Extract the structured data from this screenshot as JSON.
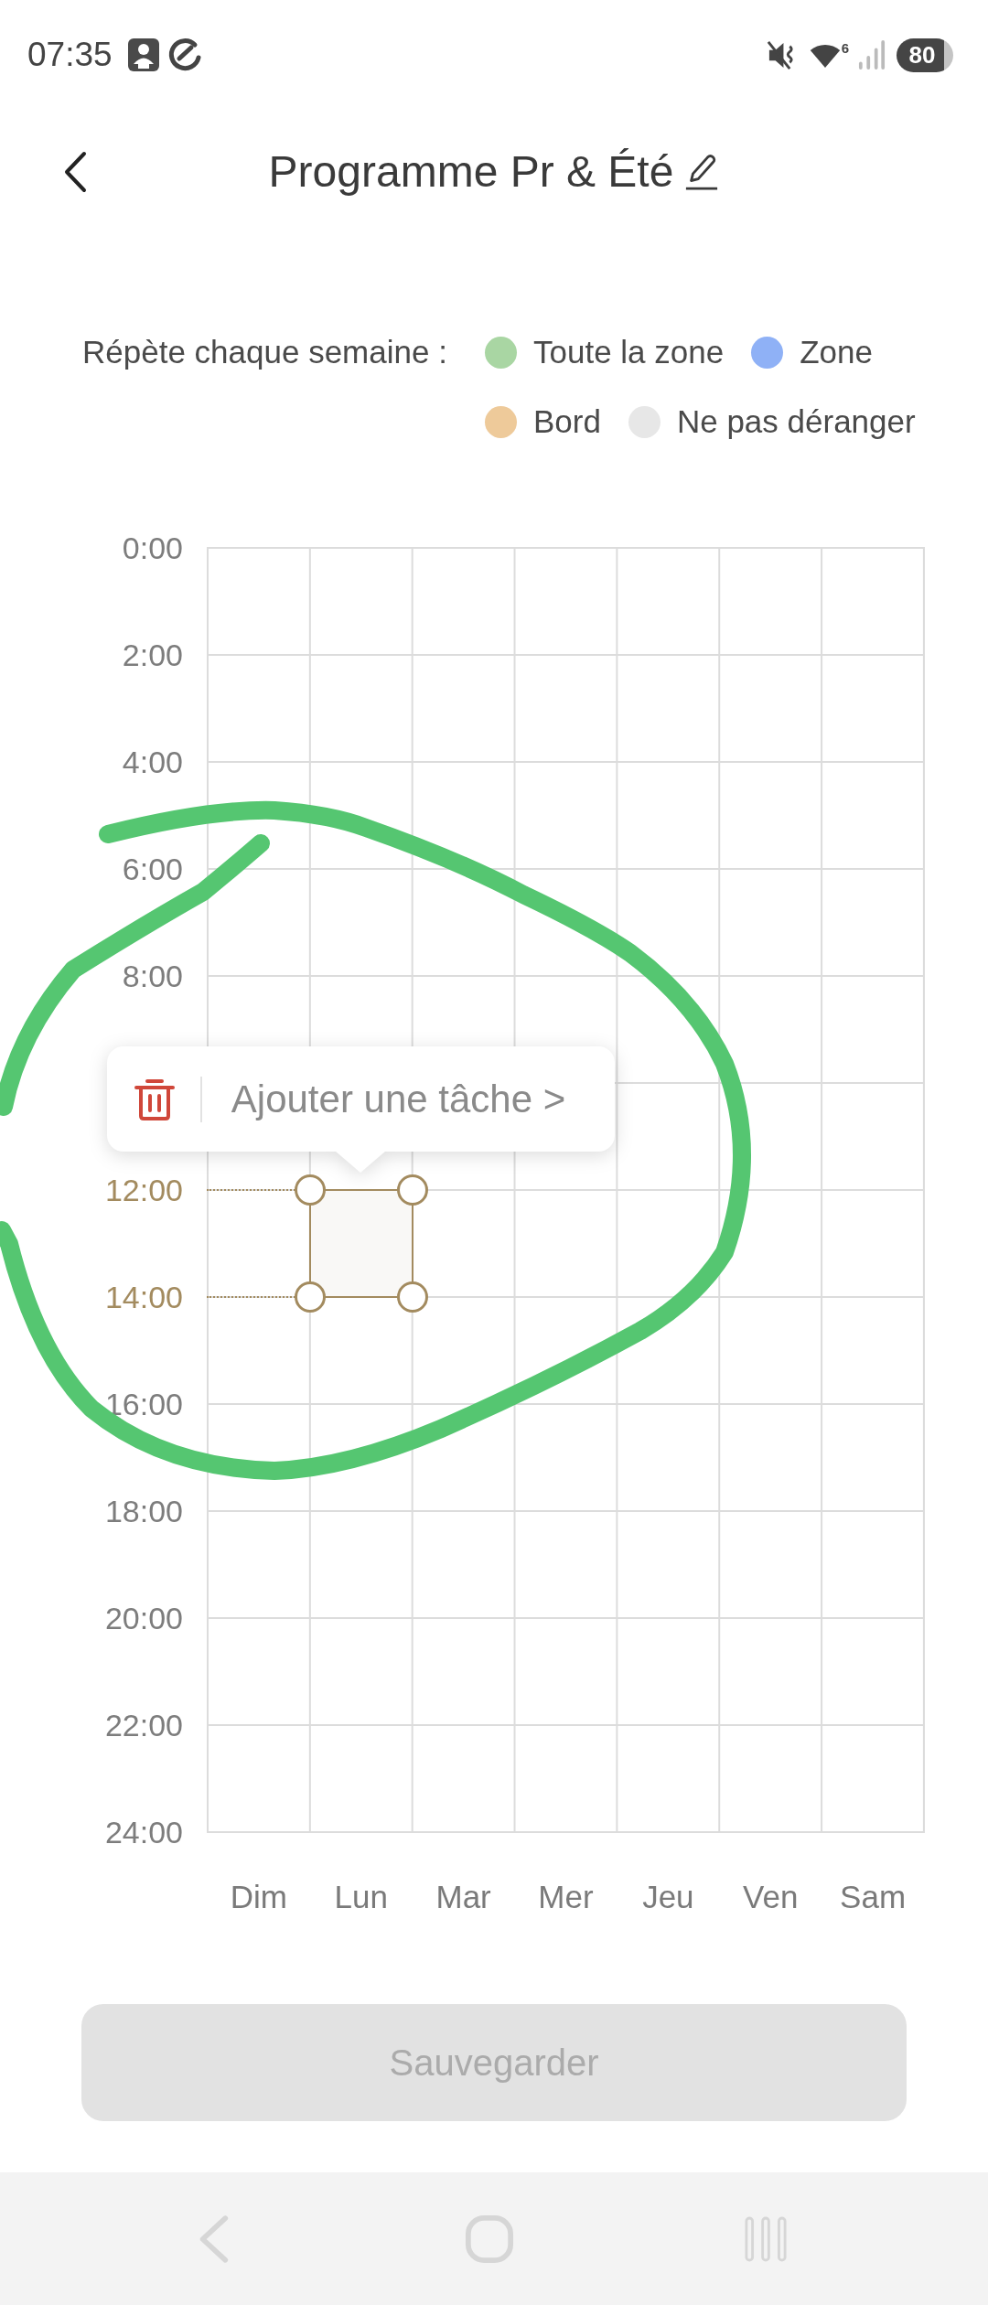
{
  "status_bar": {
    "time": "07:35",
    "wifi_label": "6",
    "battery": "80"
  },
  "header": {
    "title": "Programme Pr & Été"
  },
  "legend": {
    "label": "Répète chaque semaine :",
    "items": [
      {
        "label": "Toute la zone",
        "color": "#a9d6a3"
      },
      {
        "label": "Zone",
        "color": "#8fb1f6"
      },
      {
        "label": "Bord",
        "color": "#eeca9a"
      },
      {
        "label": "Ne pas déranger",
        "color": "#e7e7e7"
      }
    ]
  },
  "schedule": {
    "hour_labels_above_popup": [
      {
        "label": "0:00",
        "selected": false
      },
      {
        "label": "2:00",
        "selected": false
      },
      {
        "label": "4:00",
        "selected": false
      },
      {
        "label": "6:00",
        "selected": false
      },
      {
        "label": "8:00",
        "selected": false
      }
    ],
    "hour_labels_below_popup": [
      {
        "label": "12:00",
        "selected": true
      },
      {
        "label": "14:00",
        "selected": true
      },
      {
        "label": "16:00",
        "selected": false
      },
      {
        "label": "18:00",
        "selected": false
      },
      {
        "label": "20:00",
        "selected": false
      },
      {
        "label": "22:00",
        "selected": false
      },
      {
        "label": "24:00",
        "selected": false
      }
    ],
    "days": [
      {
        "label": "Dim",
        "selected": false
      },
      {
        "label": "Lun",
        "selected": true
      },
      {
        "label": "Mar",
        "selected": false
      },
      {
        "label": "Mer",
        "selected": false
      },
      {
        "label": "Jeu",
        "selected": false
      },
      {
        "label": "Ven",
        "selected": false
      },
      {
        "label": "Sam",
        "selected": false
      }
    ],
    "popup": {
      "action": "Ajouter une tâche >"
    }
  },
  "save_button": {
    "label": "Sauvegarder",
    "disabled": true
  }
}
